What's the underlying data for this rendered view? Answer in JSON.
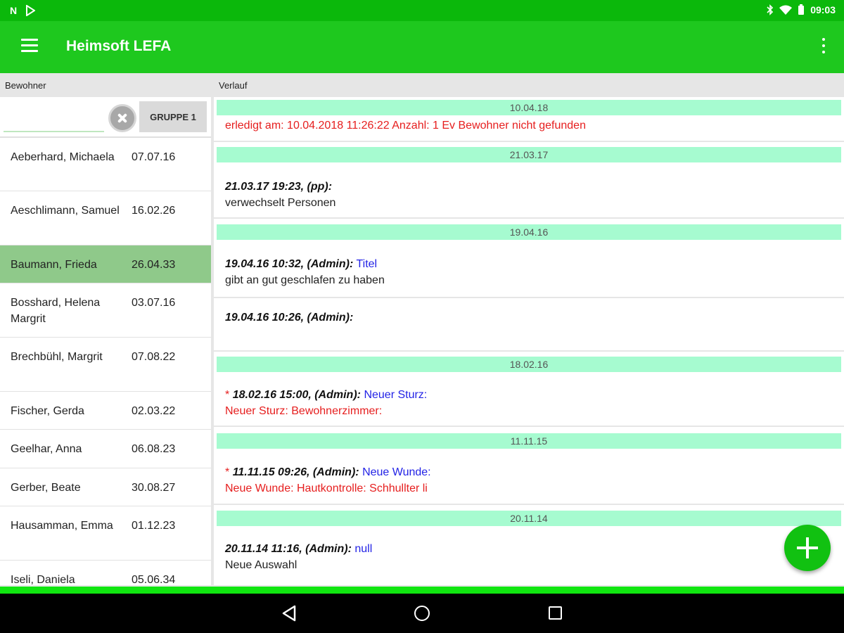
{
  "status_bar": {
    "time": "09:03",
    "icons": [
      "n-icon",
      "play-store-icon",
      "bluetooth-icon",
      "wifi-icon",
      "battery-icon"
    ]
  },
  "app_bar": {
    "title": "Heimsoft LEFA"
  },
  "sections": {
    "left": "Bewohner",
    "right": "Verlauf"
  },
  "search": {
    "value": "",
    "placeholder": "",
    "group_label": "GRUPPE 1"
  },
  "residents": [
    {
      "name": "Aeberhard, Michaela",
      "date": "07.07.16"
    },
    {
      "name": "Aeschlimann, Samuel",
      "date": "16.02.26"
    },
    {
      "name": "Baumann, Frieda",
      "date": "26.04.33",
      "selected": true
    },
    {
      "name": "Bosshard, Helena Margrit",
      "date": "03.07.16"
    },
    {
      "name": "Brechbühl, Margrit",
      "date": "07.08.22"
    },
    {
      "name": "Fischer, Gerda",
      "date": "02.03.22"
    },
    {
      "name": "Geelhar, Anna",
      "date": "06.08.23"
    },
    {
      "name": "Gerber, Beate",
      "date": "30.08.27"
    },
    {
      "name": "Hausamman, Emma",
      "date": "01.12.23"
    },
    {
      "name": "Iseli, Daniela",
      "date": "05.06.34"
    }
  ],
  "history": {
    "g0": {
      "date": "10.04.18",
      "line": "erledigt am: 10.04.2018 11:26:22 Anzahl: 1 Ev Bewohner nicht gefunden"
    },
    "g1": {
      "date": "21.03.17",
      "meta": "21.03.17 19:23, (pp):",
      "body": "verwechselt Personen"
    },
    "g2": {
      "date": "19.04.16",
      "e1_meta": "19.04.16 10:32, (Admin):",
      "e1_title": "Titel",
      "e1_body": "gibt an gut geschlafen zu haben",
      "e2_meta": "19.04.16 10:26, (Admin):"
    },
    "g3": {
      "date": "18.02.16",
      "star": "*",
      "meta": "18.02.16 15:00, (Admin):",
      "title": "Neuer Sturz:",
      "body": "Neuer Sturz: Bewohnerzimmer:"
    },
    "g4": {
      "date": "11.11.15",
      "star": "*",
      "meta": "11.11.15 09:26, (Admin):",
      "title": "Neue Wunde:",
      "body": "Neue Wunde: Hautkontrolle: Schhullter li"
    },
    "g5": {
      "date": "20.11.14",
      "meta": "20.11.14 11:16, (Admin):",
      "title": "null",
      "body": "Neue Auswahl"
    }
  },
  "colors": {
    "status_bar": "#0bb80b",
    "app_bar": "#1ec81e",
    "date_bar": "#a6fbd0",
    "selected_row": "#8fc98a",
    "fab": "#11c111",
    "alert_text": "#e61e1e",
    "title_text": "#2323e6"
  }
}
